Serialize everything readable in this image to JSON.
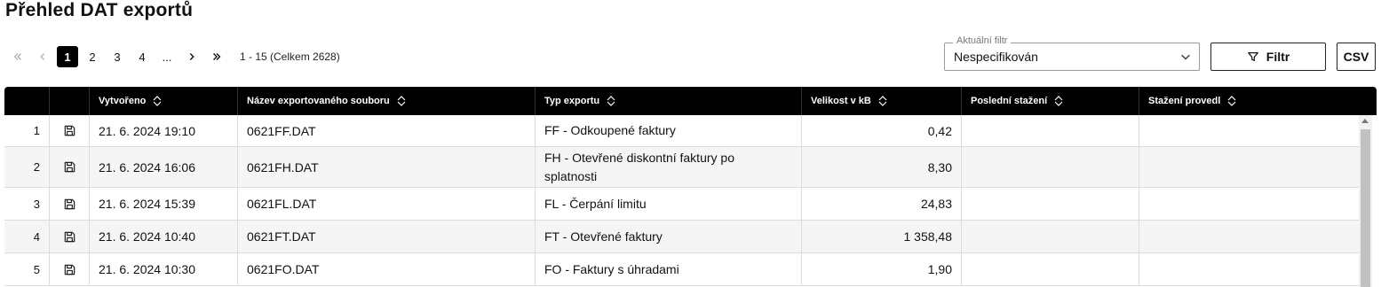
{
  "page": {
    "title": "Přehled DAT exportů"
  },
  "pagination": {
    "first_icon": "double-chevron-left-icon",
    "prev_icon": "chevron-left-icon",
    "pages": [
      "1",
      "2",
      "3",
      "4",
      "..."
    ],
    "active_page": "1",
    "next_icon": "chevron-right-icon",
    "last_icon": "double-chevron-right-icon",
    "range_text": "1 - 15 (Celkem 2628)"
  },
  "filter": {
    "legend": "Aktuální filtr",
    "value": "Nespecifikován",
    "filter_button_label": "Filtr",
    "filter_icon": "funnel-icon",
    "csv_button_label": "CSV"
  },
  "table": {
    "columns": [
      "",
      "",
      "Vytvořeno",
      "Název exportovaného souboru",
      "Typ exportu",
      "Velikost v kB",
      "Poslední stažení",
      "Stažení provedl"
    ],
    "rows": [
      {
        "index": "1",
        "created": "21. 6. 2024 19:10",
        "file": "0621FF.DAT",
        "type": "FF - Odkoupené faktury",
        "size": "0,42",
        "last_download": "",
        "downloaded_by": ""
      },
      {
        "index": "2",
        "created": "21. 6. 2024 16:06",
        "file": "0621FH.DAT",
        "type": "FH - Otevřené diskontní faktury po splatnosti",
        "size": "8,30",
        "last_download": "",
        "downloaded_by": ""
      },
      {
        "index": "3",
        "created": "21. 6. 2024 15:39",
        "file": "0621FL.DAT",
        "type": "FL - Čerpání limitu",
        "size": "24,83",
        "last_download": "",
        "downloaded_by": ""
      },
      {
        "index": "4",
        "created": "21. 6. 2024 10:40",
        "file": "0621FT.DAT",
        "type": "FT - Otevřené faktury",
        "size": "1 358,48",
        "last_download": "",
        "downloaded_by": ""
      },
      {
        "index": "5",
        "created": "21. 6. 2024 10:30",
        "file": "0621FO.DAT",
        "type": "FO - Faktury s úhradami",
        "size": "1,90",
        "last_download": "",
        "downloaded_by": ""
      }
    ],
    "row_icon": "save-floppy-icon"
  }
}
